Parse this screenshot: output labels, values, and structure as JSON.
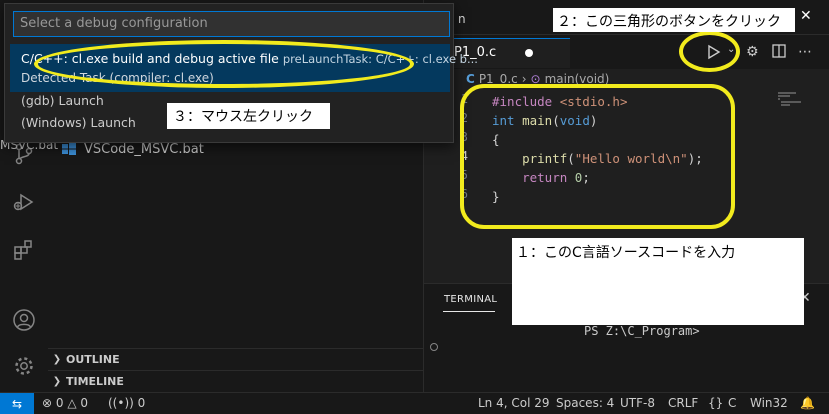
{
  "quick_pick": {
    "placeholder": "Select a debug configuration",
    "items": [
      {
        "label": "C/C++: cl.exe build and debug active file",
        "description": "preLaunchTask: C/C++: cl.exe b...",
        "detail": "Detected Task (compiler: cl.exe)"
      },
      {
        "label": "(gdb) Launch"
      },
      {
        "label": "(Windows) Launch"
      }
    ]
  },
  "sidebar": {
    "file_partial": "MSVC.bat",
    "file_name": "VSCode_MSVC.bat",
    "sections": [
      "OUTLINE",
      "TIMELINE"
    ]
  },
  "tabs": {
    "top_partial": "n",
    "active": "P1_0.c"
  },
  "breadcrumb": {
    "file": "P1_0.c",
    "symbol": "main(void)"
  },
  "editor": {
    "line_numbers": [
      "1",
      "2",
      "3",
      "4",
      "5",
      "6"
    ],
    "lines": [
      [
        {
          "t": "#include ",
          "c": "pp"
        },
        {
          "t": "<stdio.h>",
          "c": "st"
        }
      ],
      [
        {
          "t": "int ",
          "c": "kw"
        },
        {
          "t": "main",
          "c": "fn"
        },
        {
          "t": "(",
          "c": "pl"
        },
        {
          "t": "void",
          "c": "kw"
        },
        {
          "t": ")",
          "c": "pl"
        }
      ],
      [
        {
          "t": "{",
          "c": "pl"
        }
      ],
      [
        {
          "t": "    ",
          "c": "pl"
        },
        {
          "t": "printf",
          "c": "fn"
        },
        {
          "t": "(",
          "c": "pl"
        },
        {
          "t": "\"Hello world\\n\"",
          "c": "st"
        },
        {
          "t": ");",
          "c": "pl"
        }
      ],
      [
        {
          "t": "    ",
          "c": "pl"
        },
        {
          "t": "return ",
          "c": "pp"
        },
        {
          "t": "0",
          "c": "nm"
        },
        {
          "t": ";",
          "c": "pl"
        }
      ],
      [
        {
          "t": "}",
          "c": "pl"
        }
      ]
    ]
  },
  "panel": {
    "tab": "TERMINAL",
    "terminal_line": "PS Z:\\C_Program>"
  },
  "status_bar": {
    "errors": "0",
    "warnings": "0",
    "ports": "0",
    "position": "Ln 4, Col 29",
    "spaces": "Spaces: 4",
    "encoding": "UTF-8",
    "eol": "CRLF",
    "braces": "{}",
    "language": "C",
    "platform": "Win32"
  },
  "annotations": {
    "step1": "１：このC言語ソースコードを入力",
    "step2": "２：この三角形のボタンをクリック",
    "step3": "３：マウス左クリック"
  },
  "colors": {
    "accent": "#0078d4",
    "highlight": "#f2eb1d"
  }
}
